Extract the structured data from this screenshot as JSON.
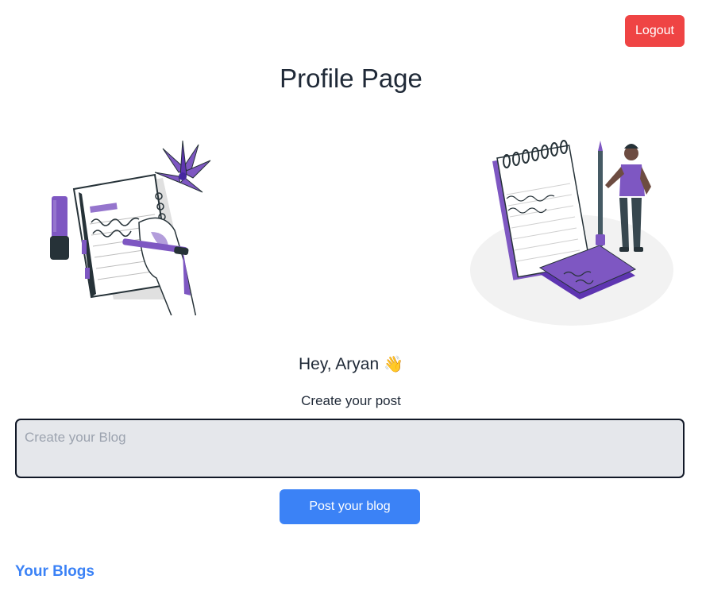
{
  "header": {
    "logout_label": "Logout",
    "page_title": "Profile Page"
  },
  "greeting": {
    "text": "Hey, Aryan",
    "emoji": "👋"
  },
  "composer": {
    "label": "Create your post",
    "placeholder": "Create your Blog",
    "value": "",
    "submit_label": "Post your blog"
  },
  "blogs": {
    "heading": "Your Blogs"
  },
  "illustrations": {
    "left": "writing-notebook-illustration",
    "right": "notes-person-illustration"
  },
  "colors": {
    "logout": "#ef4444",
    "primary": "#3b82f6",
    "accent_purple": "#7e57c2",
    "input_bg": "#e5e7eb"
  }
}
